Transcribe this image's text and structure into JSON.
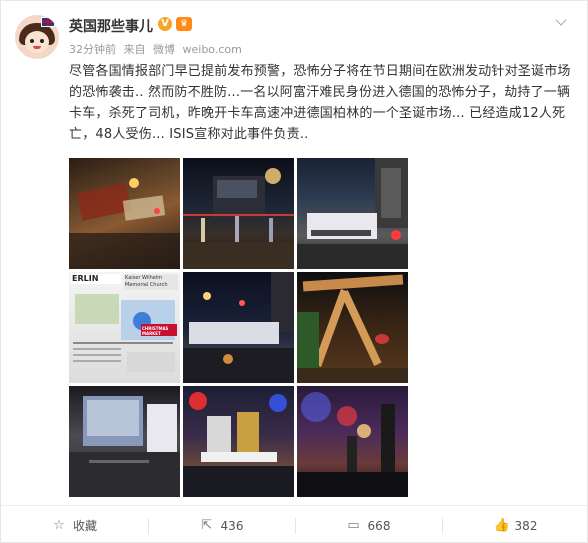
{
  "user": {
    "name": "英国那些事儿",
    "badge": "V",
    "time": "32分钟前",
    "source_prefix": "来自",
    "source": "微博",
    "site": "weibo.com"
  },
  "post": {
    "text": "尽管各国情报部门早已提前发布预警，恐怖分子将在节日期间在欧洲发动针对圣诞市场的恐怖袭击.. 然而防不胜防...一名以阿富汗难民身份进入德国的恐怖分子，劫持了一辆卡车，杀死了司机，昨晚开卡车高速冲进德国柏林的一个圣诞市场...  已经造成12人死亡，48人受伤...  ISIS宣称对此事件负责.."
  },
  "photos": [
    {
      "name": "photo-1",
      "caption": ""
    },
    {
      "name": "photo-2",
      "caption": ""
    },
    {
      "name": "photo-3",
      "caption": ""
    },
    {
      "name": "photo-4",
      "caption": ""
    },
    {
      "name": "photo-5",
      "caption": ""
    },
    {
      "name": "photo-6",
      "caption": ""
    },
    {
      "name": "photo-7",
      "caption": ""
    },
    {
      "name": "photo-8",
      "caption": ""
    },
    {
      "name": "photo-9",
      "caption": ""
    }
  ],
  "newspaper": {
    "masthead": "ERLIN",
    "headline": "CHRISTMAS MARKET",
    "line1": "Kaiser Wilhelm",
    "line2": "Memorial Church"
  },
  "actions": {
    "favorite": {
      "icon": "star-icon",
      "label": "收藏"
    },
    "repost": {
      "icon": "repost-icon",
      "count": "436"
    },
    "comment": {
      "icon": "comment-icon",
      "count": "668"
    },
    "like": {
      "icon": "thumbs-up-icon",
      "count": "382"
    }
  },
  "colors": {
    "verified_badge": "#f5a623",
    "member_badge": "#ff8c1a",
    "text": "#333333",
    "meta": "#999999"
  }
}
